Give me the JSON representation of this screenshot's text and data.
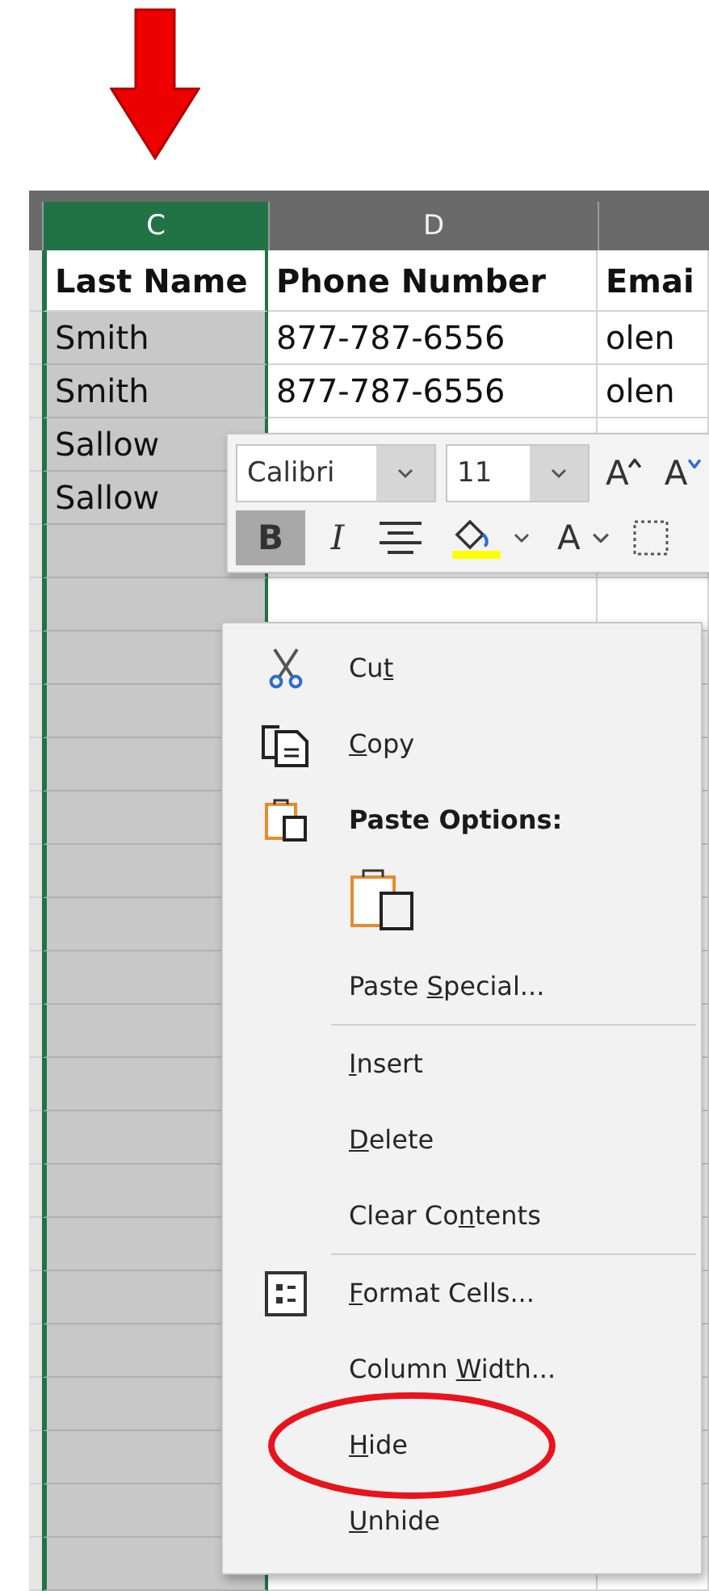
{
  "sheet": {
    "columns": [
      {
        "label": "C",
        "selected": true,
        "pointed": true
      },
      {
        "label": "D",
        "selected": false,
        "pointed": false
      },
      {
        "selected": false,
        "pointed": false
      }
    ],
    "rows": [
      [
        "Last Name",
        "Phone Number",
        "Emai"
      ],
      [
        "Smith",
        "877-787-6556",
        "olen"
      ],
      [
        "Smith",
        "877-787-6556",
        "olen"
      ],
      [
        "Sallow"
      ],
      [
        "Sallow"
      ]
    ]
  },
  "mini_toolbar": {
    "font": "Calibri",
    "size": "11",
    "buttons": [
      {
        "kind": "grow-font",
        "label": "A",
        "selected": false
      },
      {
        "kind": "shrink-font",
        "label": "A",
        "selected": false
      },
      {
        "kind": "bold",
        "label": "B",
        "selected": true
      },
      {
        "kind": "italic",
        "label": "I",
        "selected": false
      },
      {
        "kind": "align",
        "selected": false
      },
      {
        "kind": "fill",
        "selected": false
      },
      {
        "kind": "font-color",
        "label": "A",
        "selected": false
      },
      {
        "kind": "borders",
        "selected": false
      }
    ]
  },
  "context_menu": [
    {
      "kind": "cut",
      "parts": [
        {
          "text": "Cu",
          "underlined": false
        },
        {
          "text": "t",
          "underlined": true
        }
      ],
      "separator_before": false,
      "highlighted": false
    },
    {
      "kind": "copy",
      "parts": [
        {
          "text": "C",
          "underlined": true
        },
        {
          "text": "opy",
          "underlined": false
        }
      ],
      "separator_before": false,
      "highlighted": false
    },
    {
      "kind": "paste-heading",
      "parts": [
        {
          "text": "Paste Options:",
          "underlined": false
        }
      ],
      "separator_before": false,
      "highlighted": false
    },
    {
      "kind": "paste-option",
      "separator_before": false
    },
    {
      "kind": "plain",
      "parts": [
        {
          "text": "Paste ",
          "underlined": false
        },
        {
          "text": "S",
          "underlined": true
        },
        {
          "text": "pecial...",
          "underlined": false
        }
      ],
      "separator_before": false,
      "highlighted": false
    },
    {
      "kind": "plain",
      "parts": [
        {
          "text": "I",
          "underlined": true
        },
        {
          "text": "nsert",
          "underlined": false
        }
      ],
      "separator_before": true,
      "highlighted": false
    },
    {
      "kind": "plain",
      "parts": [
        {
          "text": "D",
          "underlined": true
        },
        {
          "text": "elete",
          "underlined": false
        }
      ],
      "separator_before": false,
      "highlighted": false
    },
    {
      "kind": "plain",
      "parts": [
        {
          "text": "Clear Co",
          "underlined": false
        },
        {
          "text": "n",
          "underlined": true
        },
        {
          "text": "tents",
          "underlined": false
        }
      ],
      "separator_before": false,
      "highlighted": false
    },
    {
      "kind": "format",
      "parts": [
        {
          "text": "F",
          "underlined": true
        },
        {
          "text": "ormat Cells...",
          "underlined": false
        }
      ],
      "separator_before": true,
      "highlighted": false
    },
    {
      "kind": "plain",
      "parts": [
        {
          "text": "Column ",
          "underlined": false
        },
        {
          "text": "W",
          "underlined": true
        },
        {
          "text": "idth...",
          "underlined": false
        }
      ],
      "separator_before": false,
      "highlighted": false
    },
    {
      "kind": "plain",
      "parts": [
        {
          "text": "H",
          "underlined": true
        },
        {
          "text": "ide",
          "underlined": false
        }
      ],
      "separator_before": false,
      "highlighted": true
    },
    {
      "kind": "plain",
      "parts": [
        {
          "text": "U",
          "underlined": true
        },
        {
          "text": "nhide",
          "underlined": false
        }
      ],
      "separator_before": false,
      "highlighted": false
    }
  ]
}
